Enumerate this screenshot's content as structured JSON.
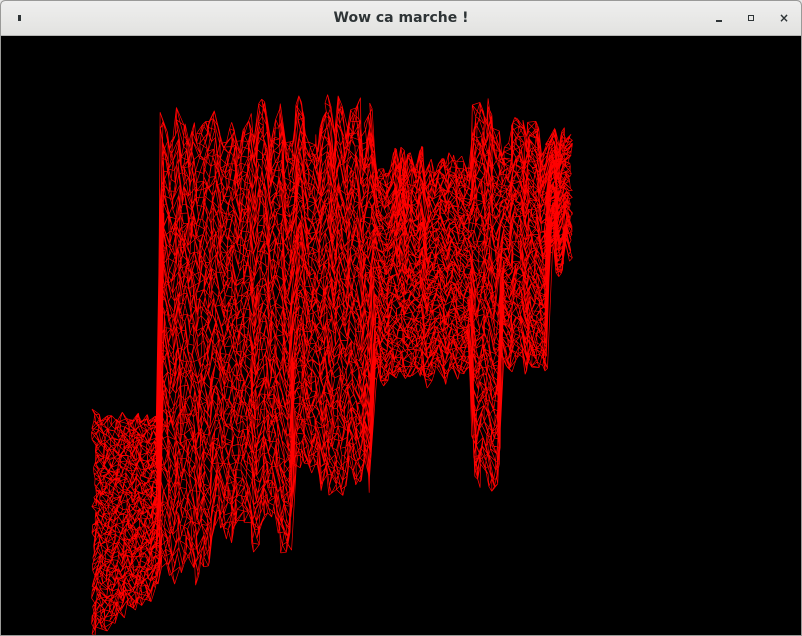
{
  "window": {
    "title": "Wow ca marche !",
    "controls": {
      "menu_icon": "window-menu-icon",
      "minimize_icon": "minimize-icon",
      "maximize_icon": "maximize-icon",
      "close_icon": "close-icon",
      "close_glyph": "×"
    }
  },
  "canvas": {
    "background_color": "#000000",
    "mesh_color": "#ff0000",
    "render_style": "wireframe"
  }
}
